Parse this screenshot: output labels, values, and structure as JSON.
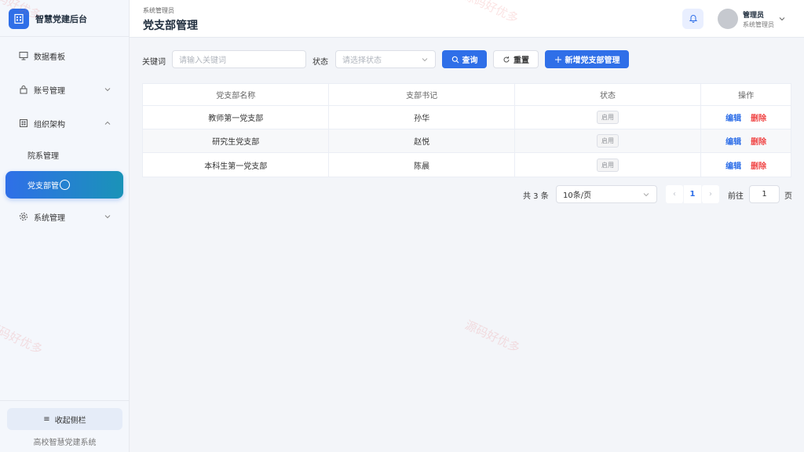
{
  "sidebar": {
    "brand": "智慧党建后台",
    "items": [
      {
        "label": "数据看板"
      },
      {
        "label": "账号管理"
      },
      {
        "label": "组织架构"
      },
      {
        "label": "院系管理"
      },
      {
        "label": "党支部管"
      },
      {
        "label": "系统管理"
      }
    ],
    "collapse_label": "收起侧栏",
    "footer": "高校智慧党建系统"
  },
  "header": {
    "breadcrumb": "系统管理员",
    "title": "党支部管理",
    "user_name": "管理员",
    "user_role": "系统管理员"
  },
  "filters": {
    "keyword_label": "关键词",
    "keyword_placeholder": "请输入关键词",
    "status_label": "状态",
    "status_placeholder": "请选择状态",
    "search_label": "查询",
    "reset_label": "重置",
    "add_label": "新增党支部管理"
  },
  "table": {
    "columns": [
      "党支部名称",
      "支部书记",
      "状态",
      "操作"
    ],
    "rows": [
      {
        "name": "教师第一党支部",
        "secretary": "孙华",
        "status": "启用"
      },
      {
        "name": "研究生党支部",
        "secretary": "赵悦",
        "status": "启用"
      },
      {
        "name": "本科生第一党支部",
        "secretary": "陈晨",
        "status": "启用"
      }
    ],
    "edit_label": "编辑",
    "delete_label": "删除"
  },
  "pagination": {
    "total": "共 3 条",
    "page_size": "10条/页",
    "current": "1",
    "goto_label": "前往",
    "goto_value": "1",
    "page_suffix": "页"
  },
  "watermark": "源码好优多",
  "colors": {
    "primary": "#2f6fe8",
    "danger": "#f04848",
    "active_gradient_end": "#1a93b8"
  }
}
